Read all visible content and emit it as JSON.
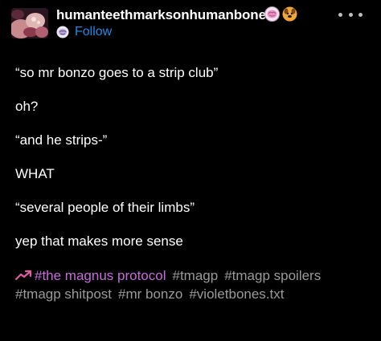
{
  "post": {
    "username": "humanteethmarksonhumanbone",
    "follow_label": "Follow",
    "icons": {
      "avatar": "avatar-photo",
      "badge_1": "pink-brain-badge-icon",
      "badge_2": "dog-face-badge-icon",
      "follow_badge": "brain-badge-icon",
      "more": "more-options-icon",
      "trend": "trending-arrow-icon"
    },
    "lines": [
      "“so mr bonzo goes to a strip club”",
      "oh?",
      "“and he strips-”",
      "WHAT",
      "“several people of their limbs”",
      "yep that makes more sense"
    ],
    "tags": [
      "#the magnus protocol",
      "#tmagp",
      "#tmagp spoilers",
      "#tmagp shitpost",
      "#mr bonzo",
      "#violetbones.txt"
    ]
  },
  "colors": {
    "background": "#000000",
    "text": "#ffffff",
    "follow": "#1e8ae6",
    "tag": "#9a9a9a",
    "featured_tag": "#c86bdc"
  }
}
